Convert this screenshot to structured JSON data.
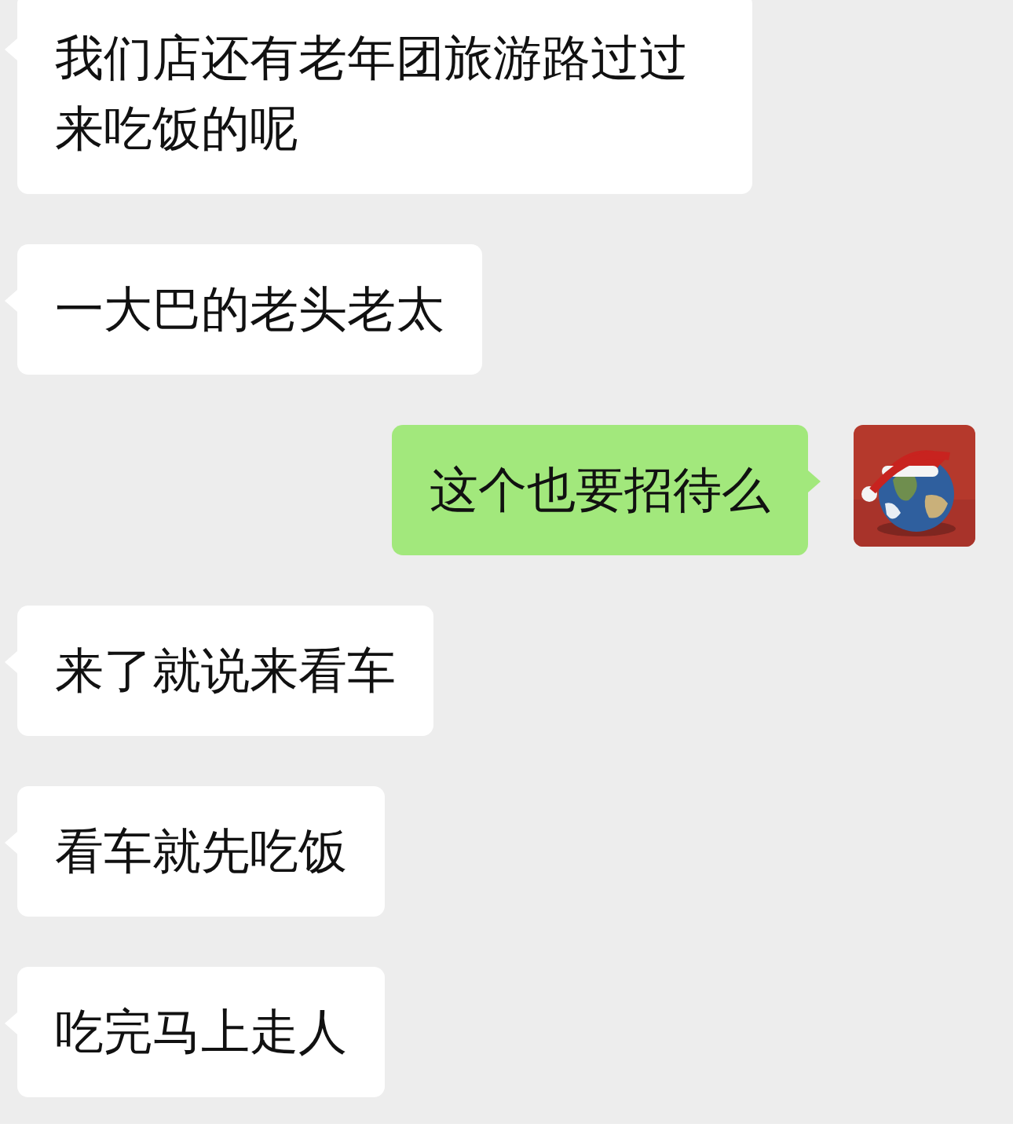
{
  "messages": [
    {
      "kind": "received",
      "text": "我们店还有老年团旅游路过过来吃饭的呢"
    },
    {
      "kind": "received",
      "text": "一大巴的老头老太"
    },
    {
      "kind": "sent",
      "text": "这个也要招待么"
    },
    {
      "kind": "received",
      "text": "来了就说来看车"
    },
    {
      "kind": "received",
      "text": "看车就先吃饭"
    },
    {
      "kind": "received",
      "text": "吃完马上走人"
    }
  ]
}
